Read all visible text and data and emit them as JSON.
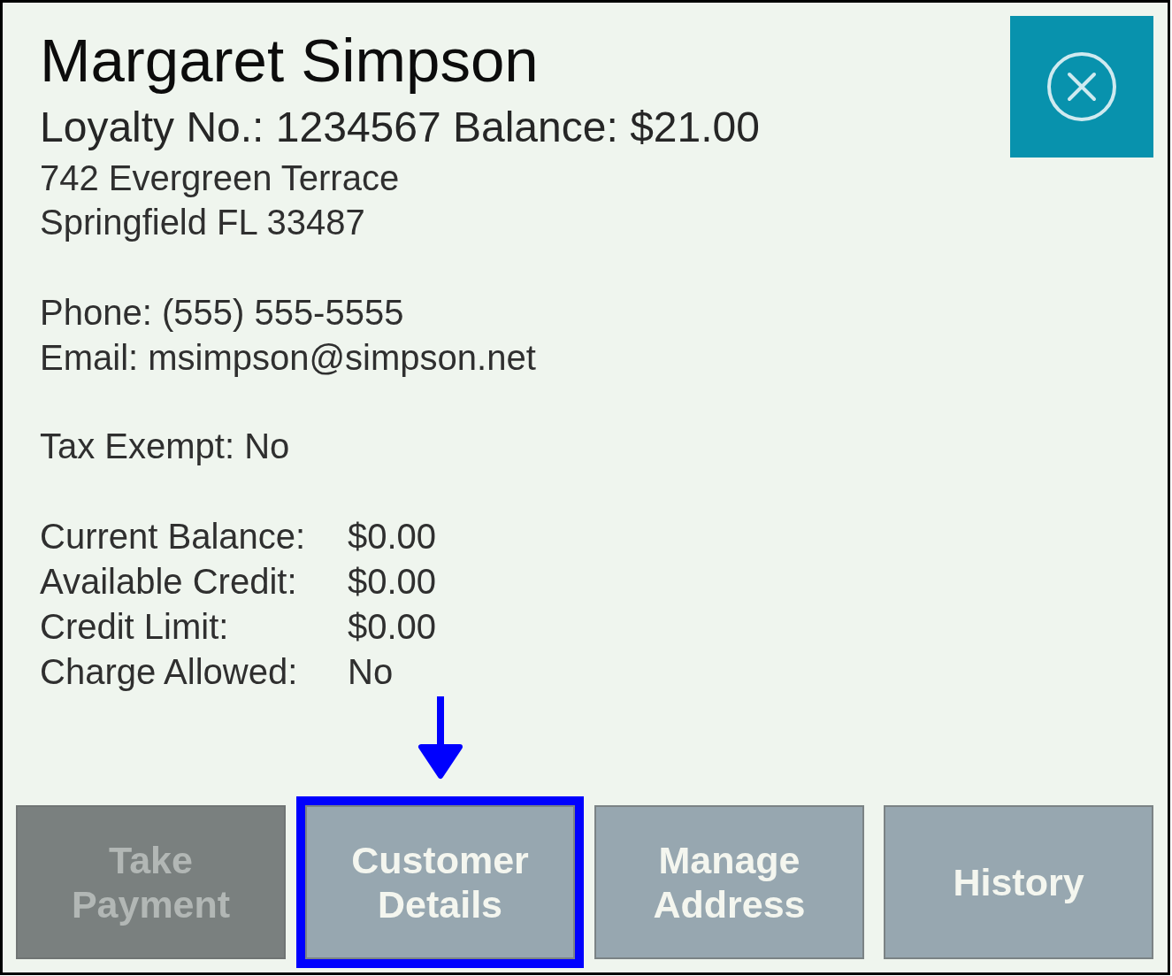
{
  "customer": {
    "name": "Margaret Simpson",
    "loyalty_line": "Loyalty No.: 1234567 Balance: $21.00",
    "address_lines": [
      "742 Evergreen Terrace",
      "Springfield FL 33487"
    ],
    "contact_lines": [
      "Phone: (555) 555-5555",
      "Email: msimpson@simpson.net"
    ],
    "tax_exempt": "Tax Exempt: No"
  },
  "account": [
    {
      "label": "Current Balance:",
      "value": "$0.00"
    },
    {
      "label": "Available Credit:",
      "value": "$0.00"
    },
    {
      "label": "Credit Limit:",
      "value": "$0.00"
    },
    {
      "label": "Charge Allowed:",
      "value": "No"
    }
  ],
  "buttons": [
    {
      "label": "Take Payment",
      "disabled": true,
      "highlighted": false
    },
    {
      "label": "Customer Details",
      "disabled": false,
      "highlighted": true
    },
    {
      "label": "Manage Address",
      "disabled": false,
      "highlighted": false
    },
    {
      "label": "History",
      "disabled": false,
      "highlighted": false
    }
  ]
}
